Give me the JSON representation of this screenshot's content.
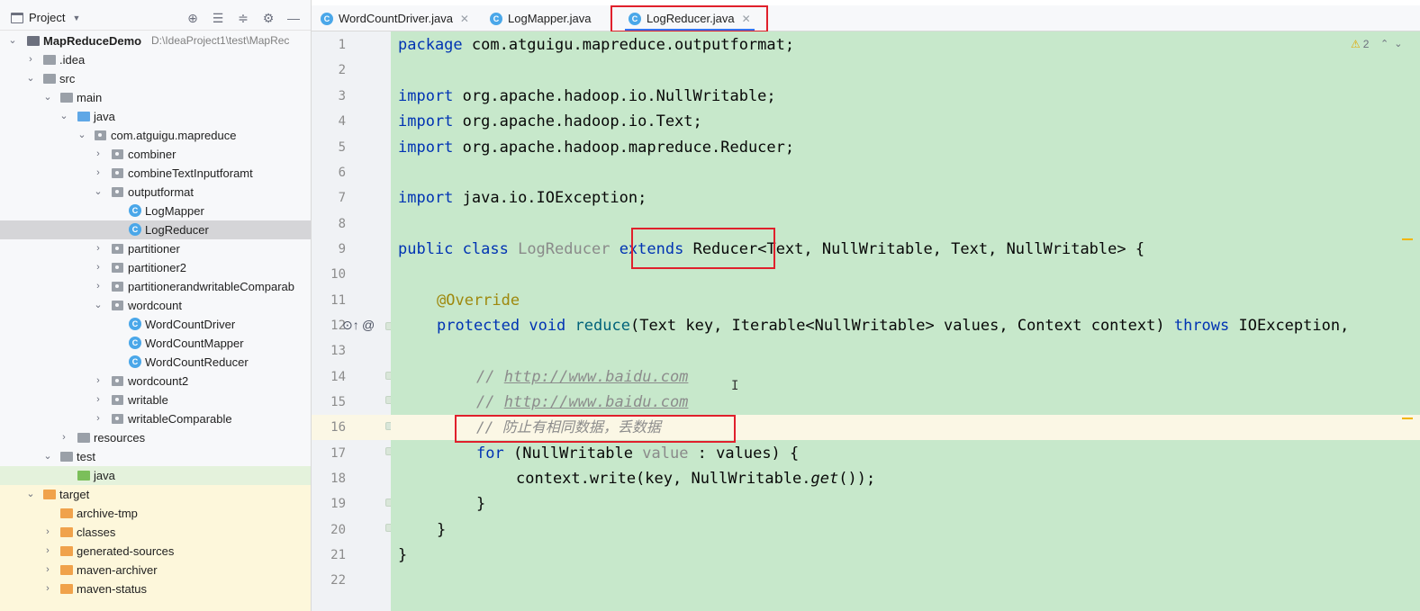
{
  "project_panel": {
    "title": "Project",
    "tree": [
      {
        "label": "MapReduceDemo",
        "hint": "D:\\IdeaProject1\\test\\MapRec",
        "bold": true
      },
      {
        "label": ".idea"
      },
      {
        "label": "src"
      },
      {
        "label": "main"
      },
      {
        "label": "java"
      },
      {
        "label": "com.atguigu.mapreduce"
      },
      {
        "label": "combiner"
      },
      {
        "label": "combineTextInputforamt"
      },
      {
        "label": "outputformat"
      },
      {
        "label": "LogMapper"
      },
      {
        "label": "LogReducer"
      },
      {
        "label": "partitioner"
      },
      {
        "label": "partitioner2"
      },
      {
        "label": "partitionerandwritableComparab"
      },
      {
        "label": "wordcount"
      },
      {
        "label": "WordCountDriver"
      },
      {
        "label": "WordCountMapper"
      },
      {
        "label": "WordCountReducer"
      },
      {
        "label": "wordcount2"
      },
      {
        "label": "writable"
      },
      {
        "label": "writableComparable"
      },
      {
        "label": "resources"
      },
      {
        "label": "test"
      },
      {
        "label": "java"
      },
      {
        "label": "target"
      },
      {
        "label": "archive-tmp"
      },
      {
        "label": "classes"
      },
      {
        "label": "generated-sources"
      },
      {
        "label": "maven-archiver"
      },
      {
        "label": "maven-status"
      }
    ]
  },
  "tabs": [
    {
      "label": "WordCountDriver.java"
    },
    {
      "label": "LogMapper.java"
    },
    {
      "label": "LogReducer.java",
      "active": true
    }
  ],
  "editor": {
    "warning_count": "2",
    "line_numbers": [
      "1",
      "2",
      "3",
      "4",
      "5",
      "6",
      "7",
      "8",
      "9",
      "10",
      "11",
      "12",
      "13",
      "14",
      "15",
      "16",
      "17",
      "18",
      "19",
      "20",
      "21",
      "22"
    ],
    "current_line": 16,
    "code": {
      "l1_kw": "package",
      "l1_rest": " com.atguigu.mapreduce.outputformat;",
      "l3_kw": "import",
      "l3_rest": " org.apache.hadoop.io.NullWritable;",
      "l4_kw": "import",
      "l4_rest": " org.apache.hadoop.io.Text;",
      "l5_kw": "import",
      "l5_rest": " org.apache.hadoop.mapreduce.Reducer;",
      "l7_kw": "import",
      "l7_rest": " java.io.IOException;",
      "l9_kw": "public class",
      "l9_name": "LogReducer",
      "l9_ext": "extends",
      "l9_rest": " Reducer<Text, NullWritable, Text, NullWritable> {",
      "l11_anno": "@Override",
      "l12_kw": "protected void",
      "l12_method": "reduce",
      "l12_rest": "(Text key, Iterable<NullWritable> values, Context context)",
      "l12_throws": "throws",
      "l12_tail": " IOException,",
      "l14_cmt": "// ",
      "l14_url": "http://www.baidu.com",
      "l15_cmt": "// ",
      "l15_url": "http://www.baidu.com",
      "l16_cmt": "// 防止有相同数据，丢数据",
      "l17_kw": "for",
      "l17_a": " (NullWritable ",
      "l17_var": "value",
      "l17_b": " : values) {",
      "l18_a": "context.write(key, NullWritable.",
      "l18_get": "get",
      "l18_b": "());",
      "l19": "}",
      "l20": "}",
      "l21": "}"
    }
  },
  "colors": {
    "editor_bg": "#c7e8cb",
    "keyword": "#0033b3",
    "annotation_box": "#e0202c",
    "selection": "#d5d5d8"
  }
}
